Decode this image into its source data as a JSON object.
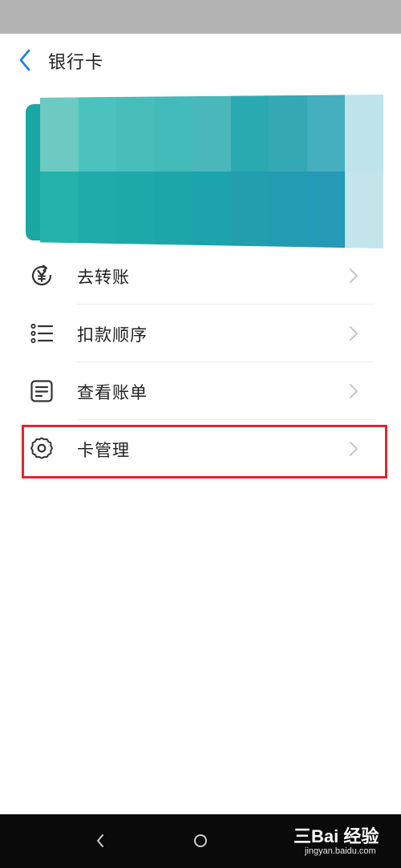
{
  "header": {
    "title": "银行卡",
    "back_icon": "chevron-left-icon"
  },
  "card": {
    "colors_top": [
      "#6dcac3",
      "#4bc2bd",
      "#48bebb",
      "#42bbba",
      "#4ab7ba",
      "#2aaab0",
      "#34a9b4",
      "#45aebe",
      "#bfe3ea"
    ],
    "colors_bottom": [
      "#25b2ab",
      "#1eabaa",
      "#1ea9a9",
      "#1da6aa",
      "#1ca3ab",
      "#229eaf",
      "#239cb2",
      "#2599b5",
      "#c4e4ec"
    ]
  },
  "menu": {
    "items": [
      {
        "label": "去转账",
        "icon": "yuan-transfer-icon"
      },
      {
        "label": "扣款顺序",
        "icon": "list-icon"
      },
      {
        "label": "查看账单",
        "icon": "bill-icon"
      },
      {
        "label": "卡管理",
        "icon": "gear-icon"
      }
    ]
  },
  "highlight": {
    "color": "#e0262f"
  },
  "nav": {
    "back_icon": "nav-back-icon",
    "home_icon": "nav-home-icon"
  },
  "watermark": {
    "main": "三Bai 经验",
    "sub": "jingyan.baidu.com"
  },
  "colors": {
    "accent": "#1a7ee6",
    "text": "#222222",
    "icon": "#333333",
    "chevron": "#c5c5c5"
  }
}
